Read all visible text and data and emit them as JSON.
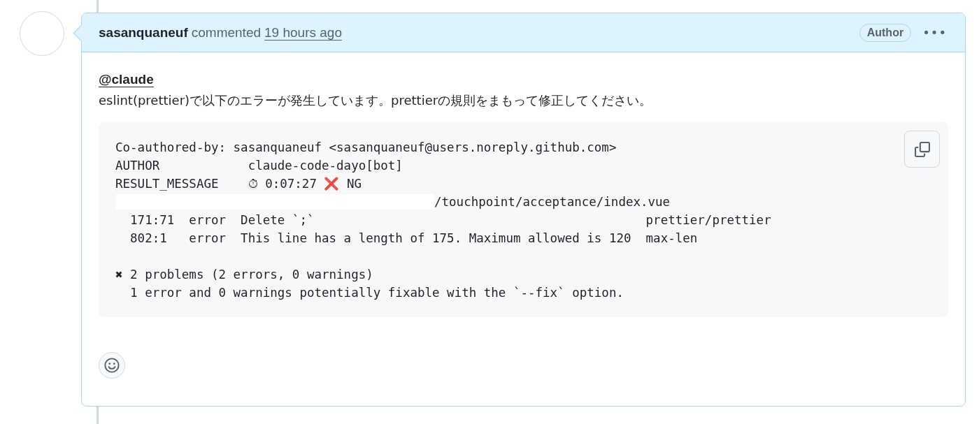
{
  "comment": {
    "author": "sasanquaneuf",
    "action": "commented",
    "time": "19 hours ago",
    "role_badge": "Author",
    "menu": "•••",
    "body": {
      "mention": "@claude",
      "text": "eslint(prettier)で以下のエラーが発生しています。prettierの規則をまもって修正してください。",
      "code_lines": [
        {
          "kind": "plain",
          "text": "Co-authored-by: sasanquaneuf <sasanquaneuf@users.noreply.github.com>"
        },
        {
          "kind": "plain",
          "text": "AUTHOR            claude-code-dayo[bot]"
        },
        {
          "kind": "plain",
          "text": "RESULT_MESSAGE    ⏱ 0:07:27 ❌ NG"
        },
        {
          "kind": "redacted",
          "text": "/touchpoint/acceptance/index.vue"
        },
        {
          "kind": "plain",
          "text": "  171:71  error  Delete `;`                                             prettier/prettier"
        },
        {
          "kind": "plain",
          "text": "  802:1   error  This line has a length of 175. Maximum allowed is 120  max-len"
        },
        {
          "kind": "blank"
        },
        {
          "kind": "plain",
          "text": "✖ 2 problems (2 errors, 0 warnings)"
        },
        {
          "kind": "plain",
          "text": "  1 error and 0 warnings potentially fixable with the `--fix` option."
        }
      ]
    }
  }
}
